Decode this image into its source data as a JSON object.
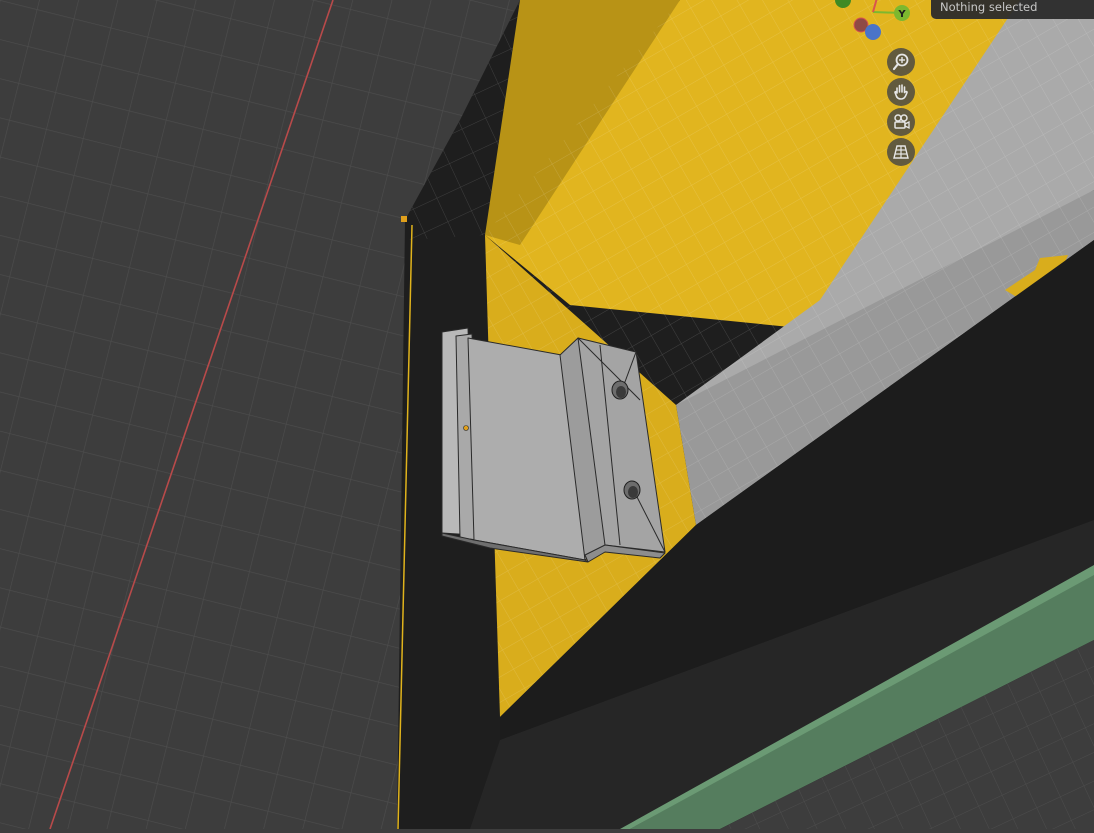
{
  "viewport": {
    "status_text": "Nothing selected",
    "gizmo": {
      "y_axis_label": "Y",
      "colors": {
        "x": "#d9544d",
        "y": "#7cb82f",
        "z": "#4a74c9",
        "y_neg": "#3f8a24",
        "x_neg": "#8f4a45"
      }
    },
    "navigation_icons": [
      "zoom-icon",
      "pan-hand-icon",
      "camera-icon",
      "perspective-grid-icon"
    ],
    "colors": {
      "background": "#3d3d3d",
      "grid_line": "#4c4c4c",
      "x_axis_line": "#b84a4a",
      "selected_face": "#e1b51f",
      "mesh_body": "#a8a8a8",
      "dark_face": "#1d1d1d",
      "green_strip": "#557d5e"
    }
  }
}
